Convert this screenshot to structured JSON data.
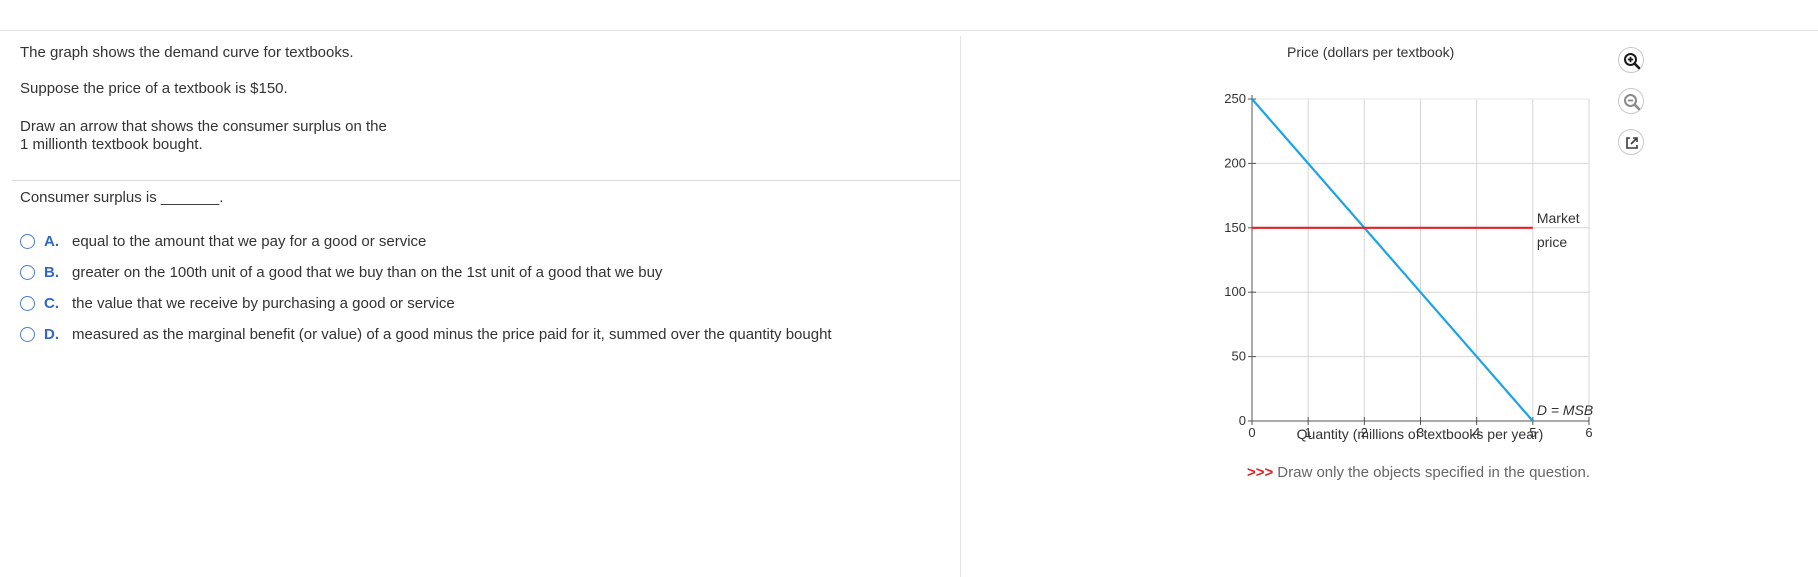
{
  "question": {
    "line1": "The graph shows the demand curve for textbooks.",
    "line2": "Suppose the price of a textbook is $150.",
    "line3a": "Draw an arrow that shows the consumer surplus on the",
    "line3b": "1 millionth textbook bought."
  },
  "prompt": {
    "text": "Consumer surplus is _______."
  },
  "choices": [
    {
      "letter": "A.",
      "text": "equal to the amount that we pay for a good or service"
    },
    {
      "letter": "B.",
      "text": "greater on the 100th unit of a good that we buy than on the 1st unit of a good that we buy"
    },
    {
      "letter": "C.",
      "text": "the value that we receive by purchasing a good or service"
    },
    {
      "letter": "D.",
      "text": "measured as the marginal benefit (or value) of a good minus the price paid for it, summed over the quantity bought"
    }
  ],
  "toolbar": {
    "zoom_in_icon": "zoom-in-icon",
    "zoom_out_icon": "zoom-out-icon",
    "popout_icon": "external-link-icon"
  },
  "instruction": {
    "arrows": ">>>",
    "text": "Draw only the objects specified in the question."
  },
  "chart_data": {
    "type": "line",
    "title": "",
    "ylabel": "Price (dollars per textbook)",
    "xlabel": "Quantity (millions of textbooks per year)",
    "xlim": [
      0,
      6
    ],
    "ylim": [
      0,
      250
    ],
    "x_ticks": [
      0,
      1,
      2,
      3,
      4,
      5,
      6
    ],
    "y_ticks": [
      0,
      50,
      100,
      150,
      200,
      250
    ],
    "grid": true,
    "series": [
      {
        "name": "D = MSB",
        "x": [
          0,
          5
        ],
        "y": [
          250,
          0
        ],
        "color": "#1aa3e8"
      },
      {
        "name": "Market price",
        "x": [
          0,
          5
        ],
        "y": [
          150,
          150
        ],
        "color": "#e32222"
      }
    ],
    "annotations": {
      "market_price_line1": "Market",
      "market_price_line2": "price",
      "demand_label": "D = MSB"
    }
  }
}
